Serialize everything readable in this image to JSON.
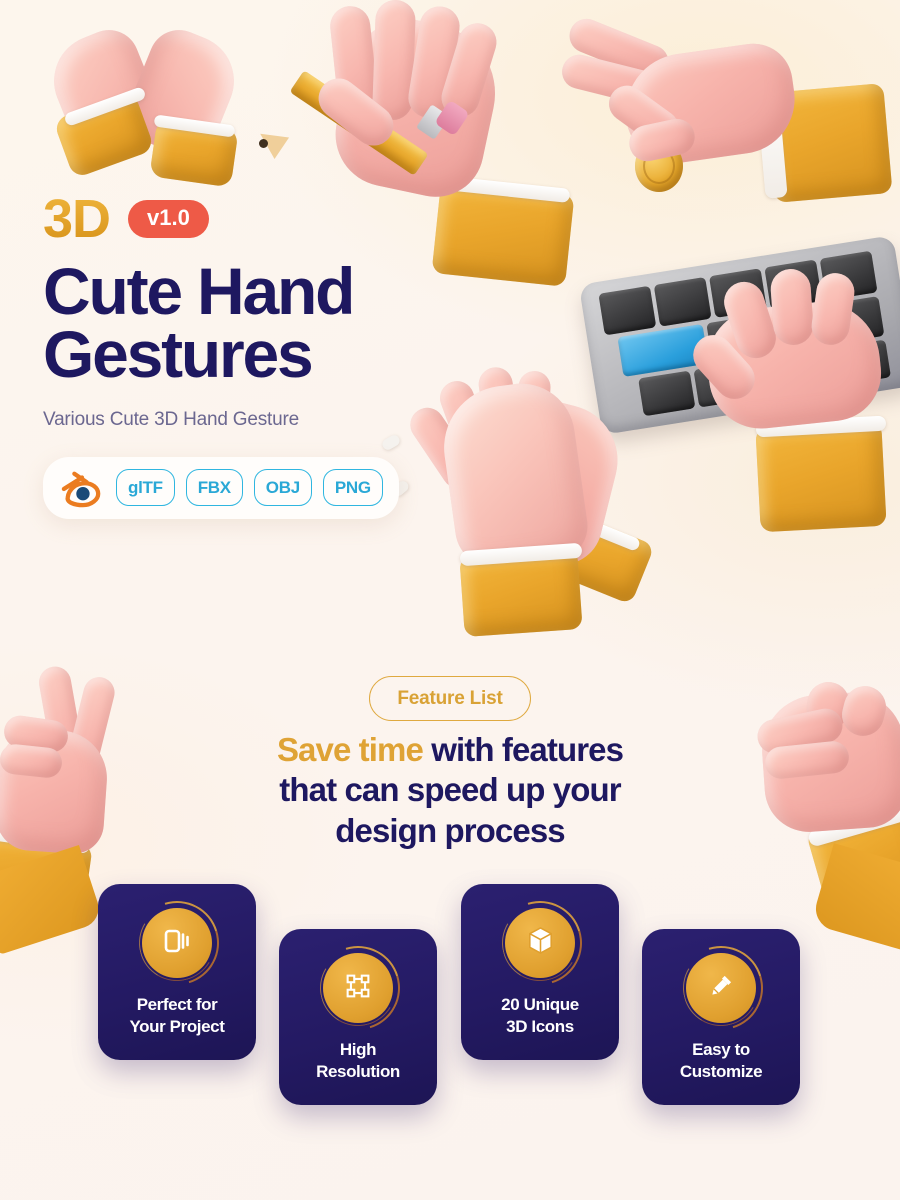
{
  "brand": {
    "label_3d": "3D",
    "version_badge": "v1.0",
    "title_line_1": "Cute Hand",
    "title_line_2": "Gestures",
    "subtitle": "Various Cute 3D Hand Gesture"
  },
  "formats": {
    "blender_icon": "blender-logo-icon",
    "items": [
      {
        "label": "glTF"
      },
      {
        "label": "FBX"
      },
      {
        "label": "OBJ"
      },
      {
        "label": "PNG"
      }
    ]
  },
  "features": {
    "pill_label": "Feature List",
    "headline_highlight": "Save time",
    "headline_rest": " with features",
    "headline_line_2": "that can speed up your",
    "headline_line_3": "design process",
    "cards": [
      {
        "title_line_1": "Perfect for",
        "title_line_2": "Your Project",
        "icon": "cards-carousel-icon"
      },
      {
        "title_line_1": "High",
        "title_line_2": "Resolution",
        "icon": "transform-box-icon"
      },
      {
        "title_line_1": "20 Unique",
        "title_line_2": "3D Icons",
        "icon": "cube-3d-icon"
      },
      {
        "title_line_1": "Easy to",
        "title_line_2": "Customize",
        "icon": "eyedropper-icon"
      }
    ]
  },
  "artwork": {
    "heart_hands": "heart-hands-3d-illustration",
    "pencil_hand": "hand-holding-pencil-3d-illustration",
    "coin_hand": "hand-holding-coin-3d-illustration",
    "typing_hand": "hand-typing-on-keyboard-3d-illustration",
    "clapping_hands": "clapping-hands-3d-illustration",
    "peace_hand": "peace-sign-hand-3d-illustration",
    "fist_hand": "fist-hand-3d-illustration"
  },
  "colors": {
    "background": "#fdf6ef",
    "navy": "#1e1860",
    "gold": "#e0a02f",
    "coral": "#ee5a47",
    "cyan": "#2fb6e0",
    "subtitle_gray": "#6b6790"
  }
}
